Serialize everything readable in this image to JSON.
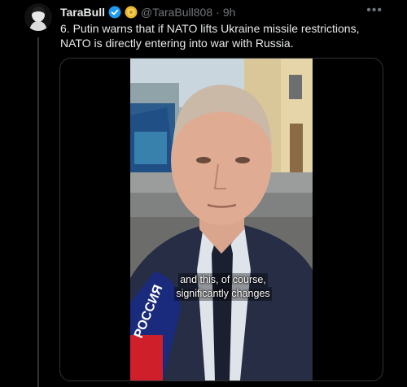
{
  "post": {
    "author_name": "TaraBull",
    "handle": "@TaraBull808",
    "separator": "·",
    "time": "9h",
    "text": "6. Putin warns that if NATO lifts Ukraine missile restrictions, NATO is directly entering into war with Russia."
  },
  "video": {
    "caption_line1": "and this, of course,",
    "caption_line2": "significantly changes",
    "mic_label": "РОССИЯ"
  },
  "colors": {
    "verified": "#1d9bf0",
    "gold_badge": "#e8b82a",
    "secondary_text": "#71767b",
    "border": "#2f3336"
  }
}
